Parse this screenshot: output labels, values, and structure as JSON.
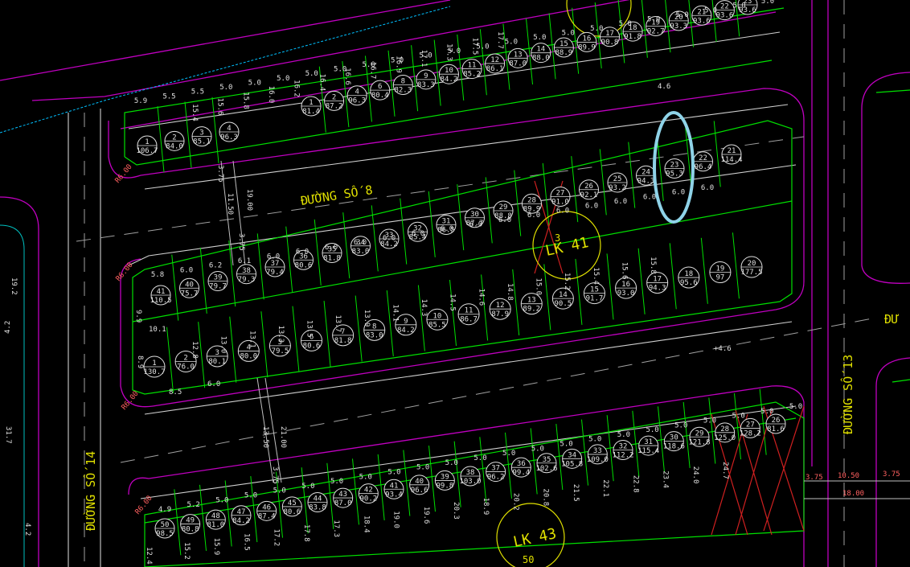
{
  "colors": {
    "background": "#000000",
    "lot_line": "#00e000",
    "boundary": "#c000c0",
    "curb": "#d0d0d0",
    "street_label": "#e0e000",
    "dim_text": "#e0e0e0",
    "cross_mark": "#d02020",
    "highlight": "#8fd3e8",
    "edge_line": "#00c0ff"
  },
  "streets": [
    {
      "id": "so8",
      "label": "ĐƯỜNG SỐ 8"
    },
    {
      "id": "so14",
      "label": "ĐƯỜNG SỐ 14"
    },
    {
      "id": "so13",
      "label": "ĐƯỜNG SỐ 13"
    },
    {
      "id": "right_partial",
      "label": "ĐƯ"
    }
  ],
  "block_labels": [
    {
      "id": "lk_mid",
      "label": "LK 41",
      "sub": "3"
    },
    {
      "id": "lk_bottom",
      "label": "LK 43",
      "sub": "50"
    }
  ],
  "lots_top_strip": [
    {
      "no": "1",
      "area": "81.4"
    },
    {
      "no": "2",
      "area": "87.2"
    },
    {
      "no": "4",
      "area": "96.3"
    },
    {
      "no": "6",
      "area": "80.4"
    },
    {
      "no": "8",
      "area": "82.3"
    },
    {
      "no": "9",
      "area": "83.3"
    },
    {
      "no": "10",
      "area": "84.2"
    },
    {
      "no": "11",
      "area": "85.2"
    },
    {
      "no": "12",
      "area": "86.1"
    },
    {
      "no": "13",
      "area": "87.0"
    },
    {
      "no": "14",
      "area": "88.0"
    },
    {
      "no": "15",
      "area": "88.9"
    },
    {
      "no": "16",
      "area": "89.9"
    },
    {
      "no": "17",
      "area": "90.8"
    },
    {
      "no": "18",
      "area": "91.8"
    },
    {
      "no": "19",
      "area": "92.7"
    },
    {
      "no": "20",
      "area": "93.3"
    },
    {
      "no": "21",
      "area": "93.6"
    },
    {
      "no": "22",
      "area": "93.6"
    },
    {
      "no": "23",
      "area": "93.6"
    }
  ],
  "lots_upper_left": [
    {
      "no": "1",
      "area": "106.7"
    },
    {
      "no": "2",
      "area": "84.0"
    },
    {
      "no": "3",
      "area": "85.1"
    },
    {
      "no": "4",
      "area": "96.3"
    }
  ],
  "lots_middle_row1": [
    {
      "no": "41",
      "area": "110.5"
    },
    {
      "no": "40",
      "area": "75.7"
    },
    {
      "no": "39",
      "area": "79.7"
    },
    {
      "no": "38",
      "area": "79.3"
    },
    {
      "no": "37",
      "area": "79.4"
    },
    {
      "no": "36",
      "area": "80.6"
    },
    {
      "no": "35",
      "area": "81.8"
    },
    {
      "no": "34",
      "area": "83.0"
    },
    {
      "no": "33",
      "area": "84.2"
    },
    {
      "no": "32",
      "area": "85.4"
    },
    {
      "no": "31",
      "area": "86.5"
    },
    {
      "no": "30",
      "area": "87.7"
    },
    {
      "no": "29",
      "area": "88.8"
    },
    {
      "no": "28",
      "area": "89.9"
    },
    {
      "no": "27",
      "area": "91.0"
    },
    {
      "no": "26",
      "area": "92.1"
    },
    {
      "no": "25",
      "area": "93.2"
    },
    {
      "no": "24",
      "area": "94.3"
    },
    {
      "no": "23",
      "area": "95.3"
    },
    {
      "no": "22",
      "area": "96.4"
    },
    {
      "no": "21",
      "area": "114.4"
    }
  ],
  "lots_middle_row2": [
    {
      "no": "1",
      "area": "130.7"
    },
    {
      "no": "2",
      "area": "76.0"
    },
    {
      "no": "3",
      "area": "80.1"
    },
    {
      "no": "4",
      "area": "80.0"
    },
    {
      "no": "5",
      "area": "79.5"
    },
    {
      "no": "6",
      "area": "80.6"
    },
    {
      "no": "7",
      "area": "81.8"
    },
    {
      "no": "8",
      "area": "83.0"
    },
    {
      "no": "9",
      "area": "84.2"
    },
    {
      "no": "10",
      "area": "85.5"
    },
    {
      "no": "11",
      "area": "86.7"
    },
    {
      "no": "12",
      "area": "87.9"
    },
    {
      "no": "13",
      "area": "89.2"
    },
    {
      "no": "14",
      "area": "90.5"
    },
    {
      "no": "15",
      "area": "91.7"
    },
    {
      "no": "16",
      "area": "93.0"
    },
    {
      "no": "17",
      "area": "94.3"
    },
    {
      "no": "18",
      "area": "95.6"
    },
    {
      "no": "19",
      "area": "97"
    },
    {
      "no": "20",
      "area": "177.5"
    }
  ],
  "lots_bottom": [
    {
      "no": "50",
      "area": "98.5"
    },
    {
      "no": "49",
      "area": "80.8"
    },
    {
      "no": "48",
      "area": "81.0"
    },
    {
      "no": "47",
      "area": "84.2"
    },
    {
      "no": "46",
      "area": "87.4"
    },
    {
      "no": "45",
      "area": "80.6"
    },
    {
      "no": "44",
      "area": "83.8"
    },
    {
      "no": "43",
      "area": "87.0"
    },
    {
      "no": "42",
      "area": "90.2"
    },
    {
      "no": "41",
      "area": "93.4"
    },
    {
      "no": "40",
      "area": "96.6"
    },
    {
      "no": "39",
      "area": "99.8"
    },
    {
      "no": "38",
      "area": "103.0"
    },
    {
      "no": "37",
      "area": "96.2"
    },
    {
      "no": "36",
      "area": "99.4"
    },
    {
      "no": "35",
      "area": "102.6"
    },
    {
      "no": "34",
      "area": "105.8"
    },
    {
      "no": "33",
      "area": "109.0"
    },
    {
      "no": "32",
      "area": "112.2"
    },
    {
      "no": "31",
      "area": "115.4"
    },
    {
      "no": "30",
      "area": "118.6"
    },
    {
      "no": "29",
      "area": "121.8"
    },
    {
      "no": "28",
      "area": "125.0"
    },
    {
      "no": "27",
      "area": "128.2"
    },
    {
      "no": "26",
      "area": "81.6"
    }
  ],
  "dims_top_front": [
    "5.9",
    "5.5",
    "5.5",
    "5.0",
    "5.0",
    "5.0",
    "5.0",
    "5.0",
    "5.0",
    "5.0",
    "5.0",
    "5.0",
    "5.0",
    "5.0",
    "5.0",
    "5.0",
    "5.0",
    "5.0",
    "5.0",
    "5.0",
    "5.0",
    "5.0",
    "5.0"
  ],
  "dims_top_depth": [
    "15.4",
    "15.6",
    "15.8",
    "16.0",
    "16.2",
    "16.4",
    "16.6",
    "16.7",
    "16.9",
    "17.1",
    "17.3",
    "17.5",
    "17.7"
  ],
  "dims_mid_front": [
    "5.8",
    "6.0",
    "6.2",
    "6.1",
    "6.0",
    "6.0",
    "6.0",
    "6.0",
    "6.0",
    "6.0",
    "6.0",
    "6.0",
    "6.0",
    "6.0",
    "6.0",
    "6.0",
    "6.0",
    "6.0",
    "6.0",
    "6.0"
  ],
  "dims_mid_depth": [
    "12.8",
    "13.0",
    "13.1",
    "13.3",
    "13.5",
    "13.7",
    "13.9",
    "14.1",
    "14.3",
    "14.5",
    "14.6",
    "14.8",
    "15.0",
    "15.2",
    "15.4",
    "15.6",
    "15.8"
  ],
  "dims_bottom_front": [
    "4.9",
    "5.2",
    "5.0",
    "5.0",
    "5.0",
    "5.0",
    "5.0",
    "5.0",
    "5.0",
    "5.0",
    "5.0",
    "5.0",
    "5.0",
    "5.0",
    "5.0",
    "5.0",
    "5.0",
    "5.0",
    "5.0",
    "5.0",
    "5.0",
    "5.0",
    "5.0"
  ],
  "dims_bottom_depth": [
    "15.2",
    "15.9",
    "16.5",
    "17.2",
    "17.8",
    "17.3",
    "18.4",
    "19.0",
    "19.6",
    "20.3",
    "18.9",
    "20.2",
    "20.8",
    "21.5",
    "22.1",
    "22.8",
    "23.4",
    "24.0",
    "24.7"
  ],
  "road_dims": {
    "elev_a": "4.6",
    "elev_b": "+4.6",
    "d1": "3.75",
    "d2": "11.50",
    "d3": "19.00",
    "d4": "3.75",
    "d5": "13.50",
    "d6": "21.00",
    "d7": "3.75",
    "r1": "3.75",
    "r2": "10.50",
    "r3": "3.75",
    "r4": "18.00",
    "left1": "19.2",
    "left2": "4.2",
    "left3": "31.7",
    "left4": "4.2",
    "left5": "9.9",
    "left6": "8.9",
    "left7": "10.1",
    "left8": "8.5",
    "left9": "6.0",
    "left10": "12.4"
  },
  "chamfer_labels": [
    "R6.00",
    "R6.00",
    "R6.00",
    "R6.00"
  ]
}
